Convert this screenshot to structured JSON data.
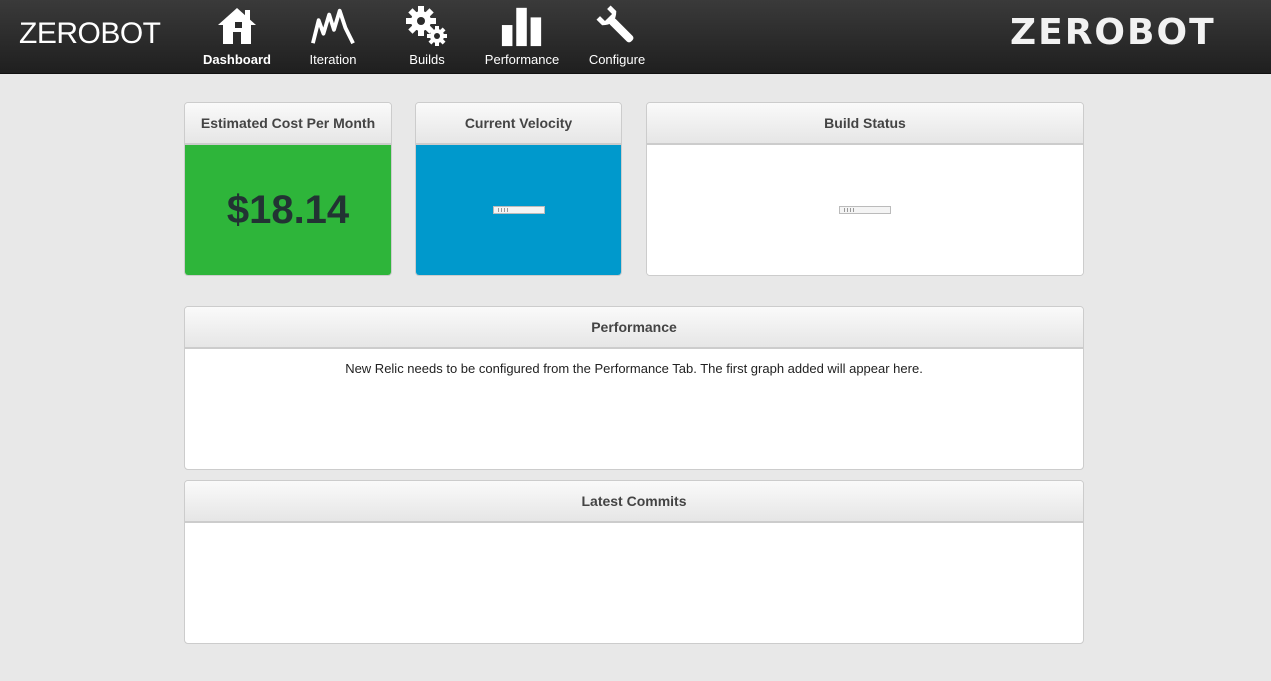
{
  "header": {
    "brand": "ZEROBOT",
    "logo_text": "ZEROBOT",
    "nav": [
      {
        "label": "Dashboard",
        "icon": "home-icon",
        "active": true
      },
      {
        "label": "Iteration",
        "icon": "iteration-chart-icon",
        "active": false
      },
      {
        "label": "Builds",
        "icon": "gears-icon",
        "active": false
      },
      {
        "label": "Performance",
        "icon": "bar-chart-icon",
        "active": false
      },
      {
        "label": "Configure",
        "icon": "wrench-icon",
        "active": false
      }
    ]
  },
  "panels": {
    "cost": {
      "title": "Estimated Cost Per Month",
      "value": "$18.14",
      "color": "#2eb53a"
    },
    "velocity": {
      "title": "Current Velocity",
      "color": "#0099cc"
    },
    "build": {
      "title": "Build Status"
    },
    "performance": {
      "title": "Performance",
      "message": "New Relic needs to be configured from the Performance Tab. The first graph added will appear here."
    },
    "commits": {
      "title": "Latest Commits"
    }
  }
}
